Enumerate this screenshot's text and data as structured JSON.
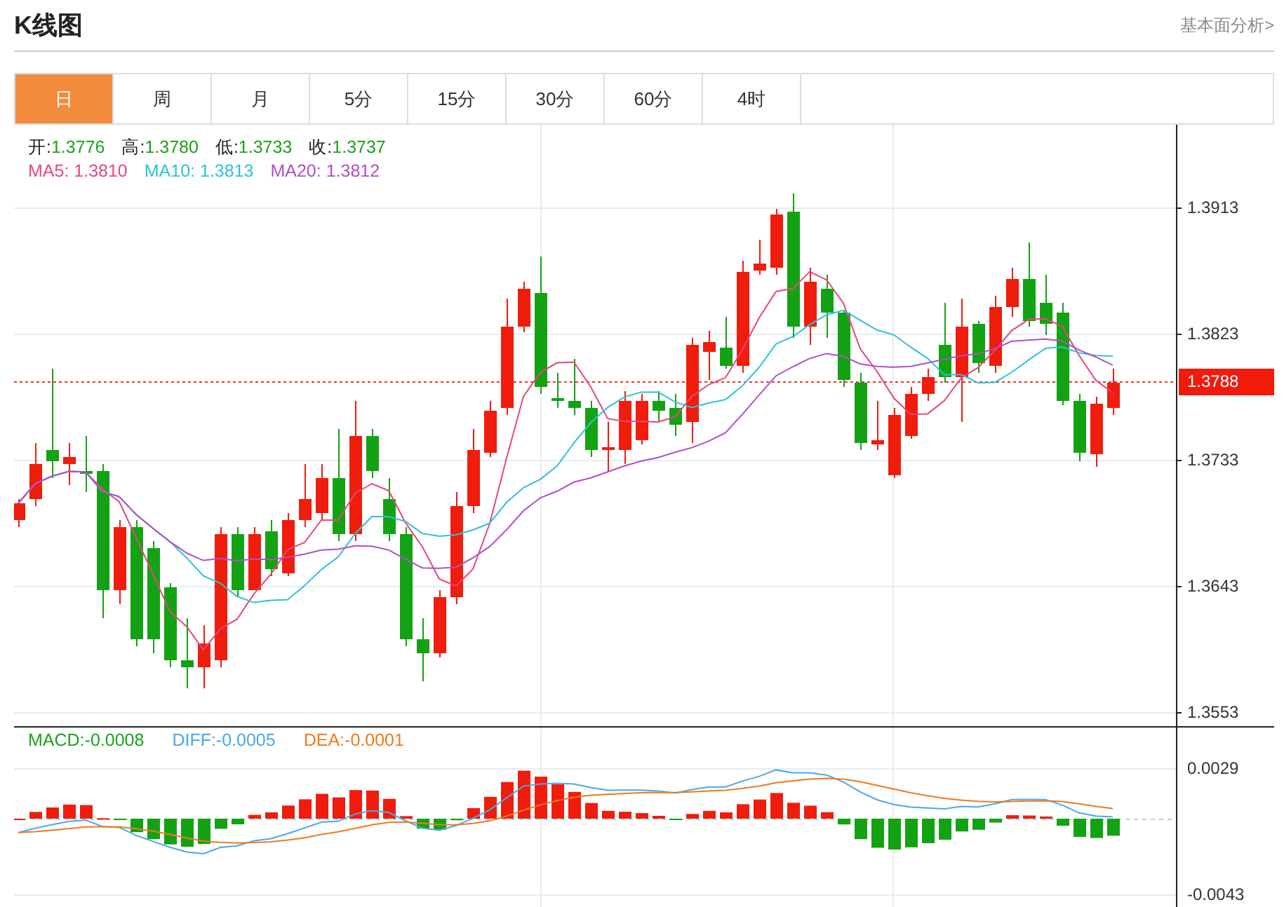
{
  "header": {
    "title": "K线图",
    "link": "基本面分析>"
  },
  "tabs": [
    {
      "label": "日",
      "selected": true
    },
    {
      "label": "周",
      "selected": false
    },
    {
      "label": "月",
      "selected": false
    },
    {
      "label": "5分",
      "selected": false
    },
    {
      "label": "15分",
      "selected": false
    },
    {
      "label": "30分",
      "selected": false
    },
    {
      "label": "60分",
      "selected": false
    },
    {
      "label": "4时",
      "selected": false
    }
  ],
  "quote": [
    {
      "label": "开:",
      "value": "1.3776"
    },
    {
      "label": "高:",
      "value": "1.3780"
    },
    {
      "label": "低:",
      "value": "1.3733"
    },
    {
      "label": "收:",
      "value": "1.3737"
    }
  ],
  "ma_legend": [
    {
      "label": "MA5:",
      "value": "1.3810",
      "color": "#e8457e"
    },
    {
      "label": "MA10:",
      "value": "1.3813",
      "color": "#2ec2d6"
    },
    {
      "label": "MA20:",
      "value": "1.3812",
      "color": "#b04fc8"
    }
  ],
  "price_axis": {
    "ticks": [
      "1.3913",
      "1.3823",
      "1.3733",
      "1.3643",
      "1.3553"
    ],
    "last_price": "1.3788"
  },
  "macd_legend": [
    {
      "label": "MACD:",
      "value": "-0.0008",
      "color": "#1aa31a"
    },
    {
      "label": "DIFF:",
      "value": "-0.0005",
      "color": "#4aa8ee"
    },
    {
      "label": "DEA:",
      "value": "-0.0001",
      "color": "#f07a1e"
    }
  ],
  "macd_axis": {
    "ticks": [
      "0.0029",
      "-0.0043"
    ]
  }
}
